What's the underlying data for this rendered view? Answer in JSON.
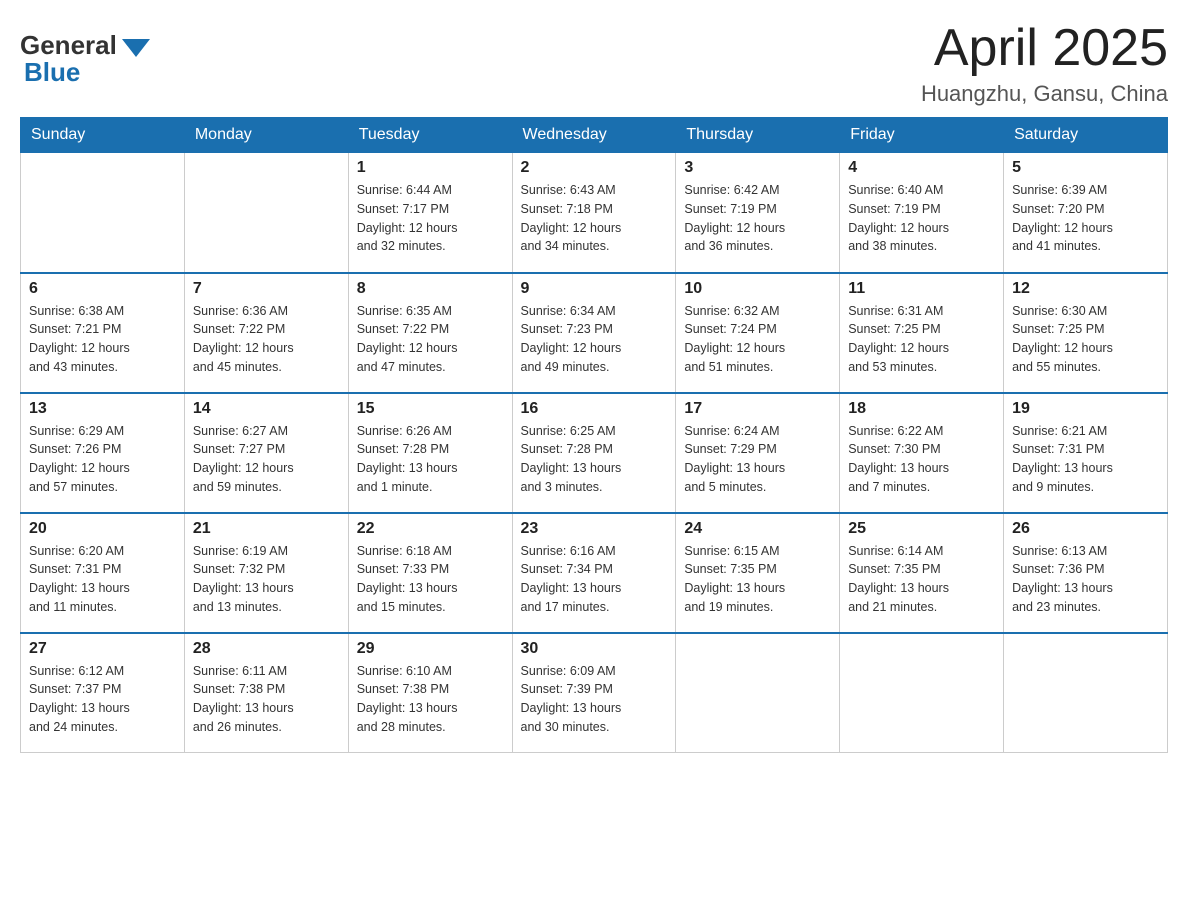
{
  "header": {
    "logo_general": "General",
    "logo_blue": "Blue",
    "month_year": "April 2025",
    "location": "Huangzhu, Gansu, China"
  },
  "days_of_week": [
    "Sunday",
    "Monday",
    "Tuesday",
    "Wednesday",
    "Thursday",
    "Friday",
    "Saturday"
  ],
  "weeks": [
    [
      {
        "day": "",
        "info": ""
      },
      {
        "day": "",
        "info": ""
      },
      {
        "day": "1",
        "info": "Sunrise: 6:44 AM\nSunset: 7:17 PM\nDaylight: 12 hours\nand 32 minutes."
      },
      {
        "day": "2",
        "info": "Sunrise: 6:43 AM\nSunset: 7:18 PM\nDaylight: 12 hours\nand 34 minutes."
      },
      {
        "day": "3",
        "info": "Sunrise: 6:42 AM\nSunset: 7:19 PM\nDaylight: 12 hours\nand 36 minutes."
      },
      {
        "day": "4",
        "info": "Sunrise: 6:40 AM\nSunset: 7:19 PM\nDaylight: 12 hours\nand 38 minutes."
      },
      {
        "day": "5",
        "info": "Sunrise: 6:39 AM\nSunset: 7:20 PM\nDaylight: 12 hours\nand 41 minutes."
      }
    ],
    [
      {
        "day": "6",
        "info": "Sunrise: 6:38 AM\nSunset: 7:21 PM\nDaylight: 12 hours\nand 43 minutes."
      },
      {
        "day": "7",
        "info": "Sunrise: 6:36 AM\nSunset: 7:22 PM\nDaylight: 12 hours\nand 45 minutes."
      },
      {
        "day": "8",
        "info": "Sunrise: 6:35 AM\nSunset: 7:22 PM\nDaylight: 12 hours\nand 47 minutes."
      },
      {
        "day": "9",
        "info": "Sunrise: 6:34 AM\nSunset: 7:23 PM\nDaylight: 12 hours\nand 49 minutes."
      },
      {
        "day": "10",
        "info": "Sunrise: 6:32 AM\nSunset: 7:24 PM\nDaylight: 12 hours\nand 51 minutes."
      },
      {
        "day": "11",
        "info": "Sunrise: 6:31 AM\nSunset: 7:25 PM\nDaylight: 12 hours\nand 53 minutes."
      },
      {
        "day": "12",
        "info": "Sunrise: 6:30 AM\nSunset: 7:25 PM\nDaylight: 12 hours\nand 55 minutes."
      }
    ],
    [
      {
        "day": "13",
        "info": "Sunrise: 6:29 AM\nSunset: 7:26 PM\nDaylight: 12 hours\nand 57 minutes."
      },
      {
        "day": "14",
        "info": "Sunrise: 6:27 AM\nSunset: 7:27 PM\nDaylight: 12 hours\nand 59 minutes."
      },
      {
        "day": "15",
        "info": "Sunrise: 6:26 AM\nSunset: 7:28 PM\nDaylight: 13 hours\nand 1 minute."
      },
      {
        "day": "16",
        "info": "Sunrise: 6:25 AM\nSunset: 7:28 PM\nDaylight: 13 hours\nand 3 minutes."
      },
      {
        "day": "17",
        "info": "Sunrise: 6:24 AM\nSunset: 7:29 PM\nDaylight: 13 hours\nand 5 minutes."
      },
      {
        "day": "18",
        "info": "Sunrise: 6:22 AM\nSunset: 7:30 PM\nDaylight: 13 hours\nand 7 minutes."
      },
      {
        "day": "19",
        "info": "Sunrise: 6:21 AM\nSunset: 7:31 PM\nDaylight: 13 hours\nand 9 minutes."
      }
    ],
    [
      {
        "day": "20",
        "info": "Sunrise: 6:20 AM\nSunset: 7:31 PM\nDaylight: 13 hours\nand 11 minutes."
      },
      {
        "day": "21",
        "info": "Sunrise: 6:19 AM\nSunset: 7:32 PM\nDaylight: 13 hours\nand 13 minutes."
      },
      {
        "day": "22",
        "info": "Sunrise: 6:18 AM\nSunset: 7:33 PM\nDaylight: 13 hours\nand 15 minutes."
      },
      {
        "day": "23",
        "info": "Sunrise: 6:16 AM\nSunset: 7:34 PM\nDaylight: 13 hours\nand 17 minutes."
      },
      {
        "day": "24",
        "info": "Sunrise: 6:15 AM\nSunset: 7:35 PM\nDaylight: 13 hours\nand 19 minutes."
      },
      {
        "day": "25",
        "info": "Sunrise: 6:14 AM\nSunset: 7:35 PM\nDaylight: 13 hours\nand 21 minutes."
      },
      {
        "day": "26",
        "info": "Sunrise: 6:13 AM\nSunset: 7:36 PM\nDaylight: 13 hours\nand 23 minutes."
      }
    ],
    [
      {
        "day": "27",
        "info": "Sunrise: 6:12 AM\nSunset: 7:37 PM\nDaylight: 13 hours\nand 24 minutes."
      },
      {
        "day": "28",
        "info": "Sunrise: 6:11 AM\nSunset: 7:38 PM\nDaylight: 13 hours\nand 26 minutes."
      },
      {
        "day": "29",
        "info": "Sunrise: 6:10 AM\nSunset: 7:38 PM\nDaylight: 13 hours\nand 28 minutes."
      },
      {
        "day": "30",
        "info": "Sunrise: 6:09 AM\nSunset: 7:39 PM\nDaylight: 13 hours\nand 30 minutes."
      },
      {
        "day": "",
        "info": ""
      },
      {
        "day": "",
        "info": ""
      },
      {
        "day": "",
        "info": ""
      }
    ]
  ]
}
